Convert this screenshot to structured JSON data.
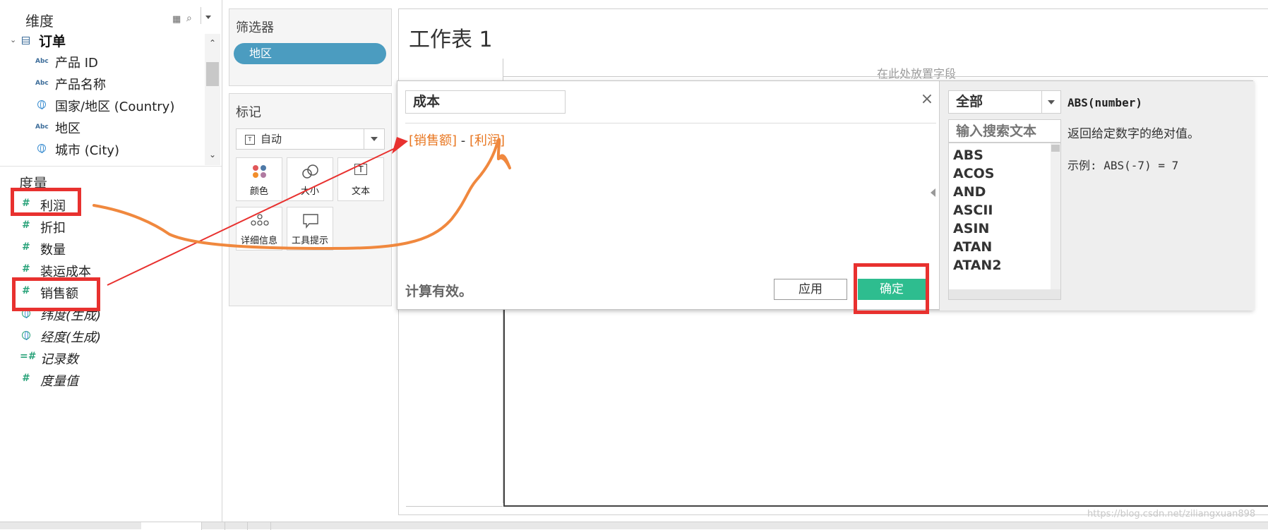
{
  "data_pane": {
    "dimensions_header": "维度",
    "table_name": "订单",
    "dimensions": [
      {
        "icon": "abc",
        "label": "产品 ID"
      },
      {
        "icon": "abc",
        "label": "产品名称"
      },
      {
        "icon": "globe",
        "label": "国家/地区 (Country)"
      },
      {
        "icon": "abc",
        "label": "地区"
      },
      {
        "icon": "globe",
        "label": "城市 (City)"
      }
    ],
    "measures_header": "度量",
    "measures": [
      {
        "icon": "hash",
        "label": "利润"
      },
      {
        "icon": "hash",
        "label": "折扣"
      },
      {
        "icon": "hash",
        "label": "数量"
      },
      {
        "icon": "hash",
        "label": "装运成本"
      },
      {
        "icon": "hash",
        "label": "销售额"
      },
      {
        "icon": "globe",
        "label": "纬度(生成)"
      },
      {
        "icon": "globe",
        "label": "经度(生成)"
      },
      {
        "icon": "hash",
        "label": "记录数"
      },
      {
        "icon": "hash",
        "label": "度量值"
      }
    ]
  },
  "filters_card": {
    "title": "筛选器",
    "pill": "地区"
  },
  "marks_card": {
    "title": "标记",
    "mark_type": "自动",
    "buttons": [
      {
        "label": "颜色"
      },
      {
        "label": "大小"
      },
      {
        "label": "文本"
      },
      {
        "label": "详细信息"
      },
      {
        "label": "工具提示"
      }
    ]
  },
  "sheet": {
    "title": "工作表 1",
    "drop_hint": "在此处放置字段"
  },
  "calc_dialog": {
    "name": "成本",
    "formula_field_1": "[销售额]",
    "formula_op": "-",
    "formula_field_2": "[利润]",
    "status": "计算有效。",
    "apply_label": "应用",
    "ok_label": "确定",
    "function_category": "全部",
    "function_search_placeholder": "输入搜索文本",
    "functions": [
      "ABS",
      "ACOS",
      "AND",
      "ASCII",
      "ASIN",
      "ATAN",
      "ATAN2"
    ],
    "fn_signature": "ABS(number)",
    "fn_description": "返回给定数字的绝对值。",
    "fn_example": "示例: ABS(-7) = 7"
  },
  "colors": {
    "accent_green": "#2ebd8f",
    "pill_blue": "#4b9cc0",
    "annotation_red": "#e8312f",
    "annotation_orange": "#f0883e",
    "formula_orange": "#e87722"
  },
  "watermark": "https://blog.csdn.net/ziliangxuan898"
}
